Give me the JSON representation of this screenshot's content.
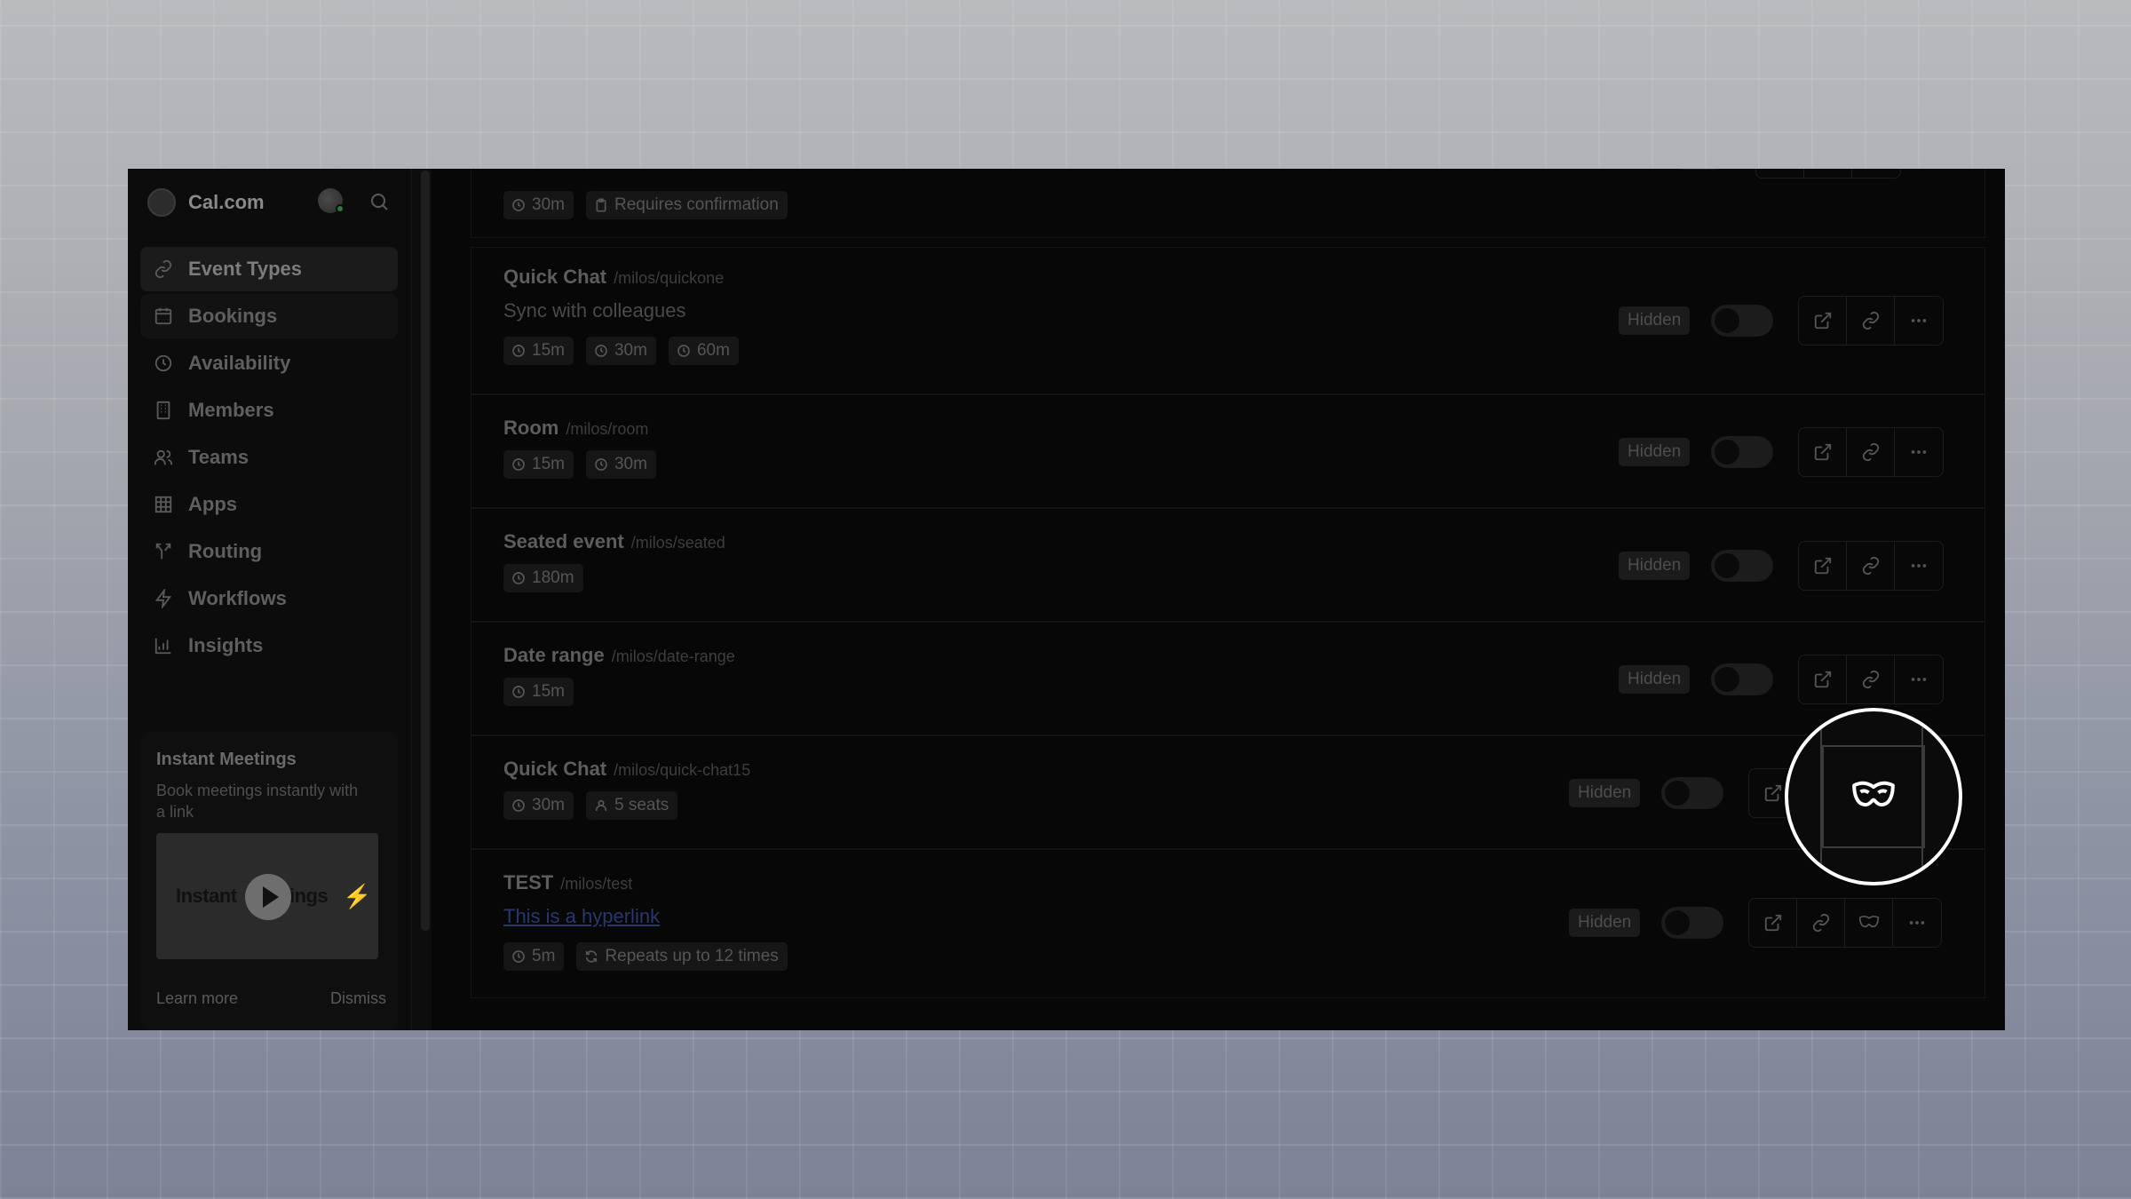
{
  "app": {
    "name": "Cal.com",
    "logo_text": "Cal.com"
  },
  "sidebar": {
    "items": [
      {
        "label": "Event Types",
        "icon": "link-icon"
      },
      {
        "label": "Bookings",
        "icon": "calendar-icon"
      },
      {
        "label": "Availability",
        "icon": "clock-icon"
      },
      {
        "label": "Members",
        "icon": "building-icon"
      },
      {
        "label": "Teams",
        "icon": "users-icon"
      },
      {
        "label": "Apps",
        "icon": "grid-icon"
      },
      {
        "label": "Routing",
        "icon": "split-icon"
      },
      {
        "label": "Workflows",
        "icon": "zap-icon"
      },
      {
        "label": "Insights",
        "icon": "bar-chart-icon"
      }
    ],
    "promo": {
      "title": "Instant Meetings",
      "description": "Book meetings instantly with a link",
      "video_text_left": "Instant",
      "video_text_right": "ings",
      "learn_more": "Learn more",
      "dismiss": "Dismiss"
    }
  },
  "event_types": {
    "hidden_label": "Hidden",
    "items": [
      {
        "title": "",
        "slug": "",
        "badges": [
          "30m",
          "Requires confirmation"
        ]
      },
      {
        "title": "Quick Chat",
        "slug": "/milos/quickone",
        "description": "Sync with colleagues",
        "badges": [
          "15m",
          "30m",
          "60m"
        ]
      },
      {
        "title": "Room",
        "slug": "/milos/room",
        "badges": [
          "15m",
          "30m"
        ]
      },
      {
        "title": "Seated event",
        "slug": "/milos/seated",
        "badges": [
          "180m"
        ]
      },
      {
        "title": "Date range",
        "slug": "/milos/date-range",
        "badges": [
          "15m"
        ]
      },
      {
        "title": "Quick Chat",
        "slug": "/milos/quick-chat15",
        "badges": [
          "30m",
          "5 seats"
        ]
      },
      {
        "title": "TEST",
        "slug": "/milos/test",
        "link": "This is a hyperlink",
        "badges": [
          "5m",
          "Repeats up to 12 times"
        ]
      }
    ]
  },
  "highlight": {
    "icon": "incognito-mask-icon"
  },
  "colors": {
    "background": "#070707",
    "link": "#28386a",
    "spotlight_ring": "#ffffff"
  }
}
